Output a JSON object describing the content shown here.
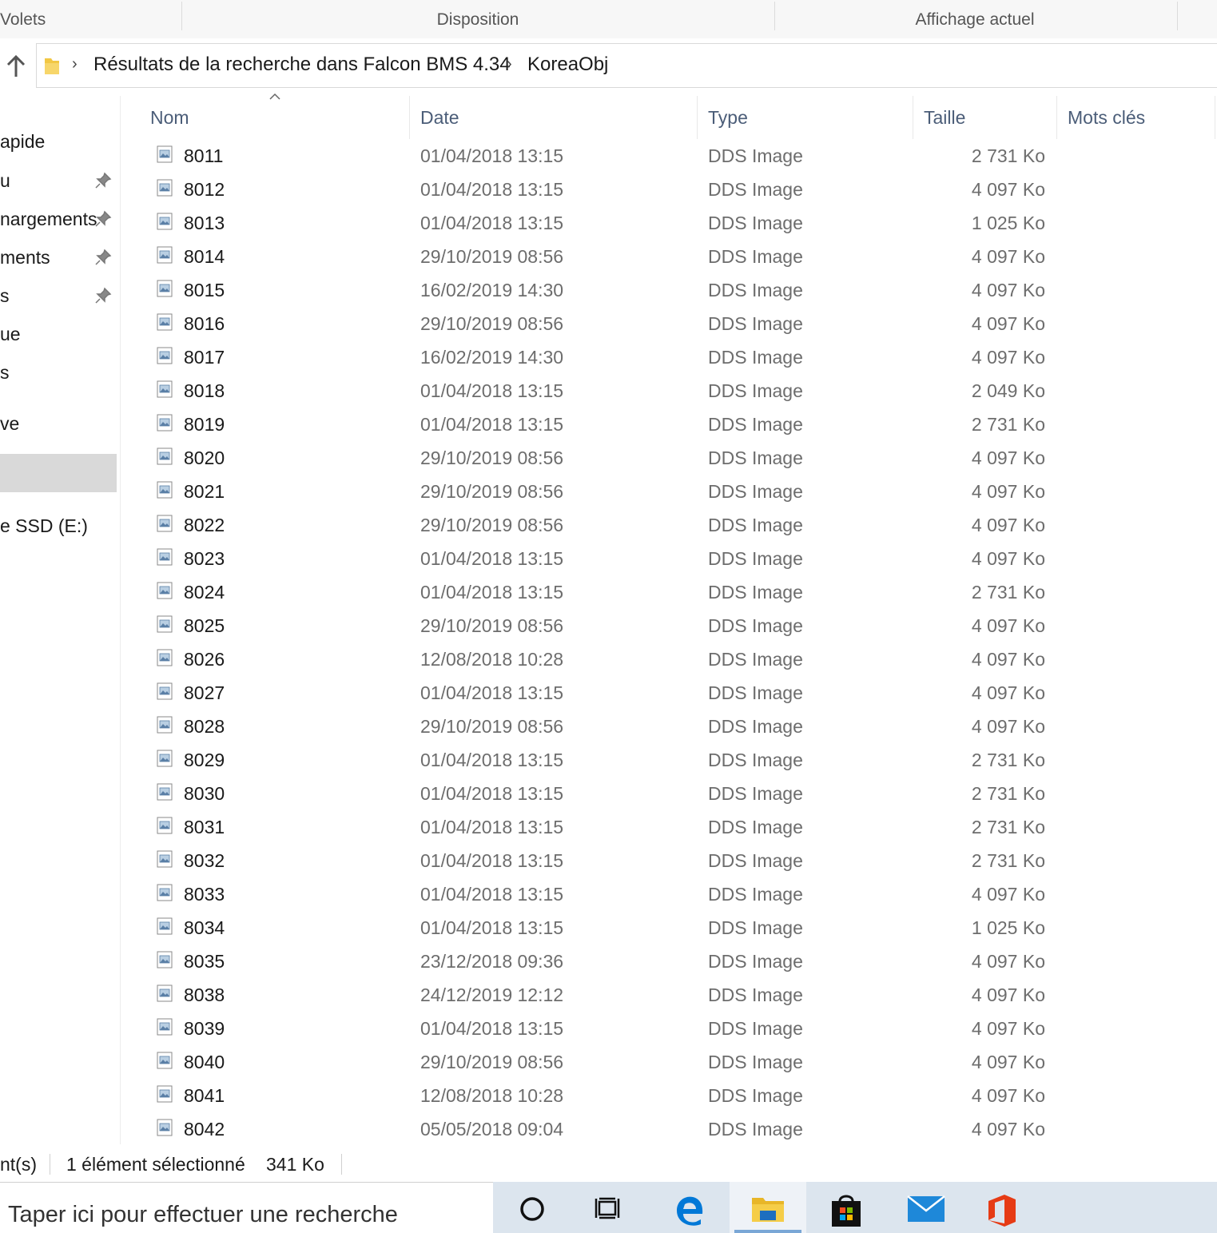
{
  "ribbon": {
    "groups": [
      "Volets",
      "Disposition",
      "Affichage actuel"
    ]
  },
  "address": {
    "crumbs": [
      "Résultats de la recherche dans Falcon BMS 4.34",
      "KoreaObj"
    ]
  },
  "nav_pane": {
    "items": [
      "apide",
      "u",
      "nargements",
      "ments",
      "s",
      "ue",
      "s",
      "ve",
      "e SSD (E:)"
    ]
  },
  "columns": {
    "name": "Nom",
    "date": "Date",
    "type": "Type",
    "size": "Taille",
    "keywords": "Mots clés"
  },
  "files": [
    {
      "name": "8011",
      "date": "01/04/2018 13:15",
      "type": "DDS Image",
      "size": "2 731 Ko"
    },
    {
      "name": "8012",
      "date": "01/04/2018 13:15",
      "type": "DDS Image",
      "size": "4 097 Ko"
    },
    {
      "name": "8013",
      "date": "01/04/2018 13:15",
      "type": "DDS Image",
      "size": "1 025 Ko"
    },
    {
      "name": "8014",
      "date": "29/10/2019 08:56",
      "type": "DDS Image",
      "size": "4 097 Ko"
    },
    {
      "name": "8015",
      "date": "16/02/2019 14:30",
      "type": "DDS Image",
      "size": "4 097 Ko"
    },
    {
      "name": "8016",
      "date": "29/10/2019 08:56",
      "type": "DDS Image",
      "size": "4 097 Ko"
    },
    {
      "name": "8017",
      "date": "16/02/2019 14:30",
      "type": "DDS Image",
      "size": "4 097 Ko"
    },
    {
      "name": "8018",
      "date": "01/04/2018 13:15",
      "type": "DDS Image",
      "size": "2 049 Ko"
    },
    {
      "name": "8019",
      "date": "01/04/2018 13:15",
      "type": "DDS Image",
      "size": "2 731 Ko"
    },
    {
      "name": "8020",
      "date": "29/10/2019 08:56",
      "type": "DDS Image",
      "size": "4 097 Ko"
    },
    {
      "name": "8021",
      "date": "29/10/2019 08:56",
      "type": "DDS Image",
      "size": "4 097 Ko"
    },
    {
      "name": "8022",
      "date": "29/10/2019 08:56",
      "type": "DDS Image",
      "size": "4 097 Ko"
    },
    {
      "name": "8023",
      "date": "01/04/2018 13:15",
      "type": "DDS Image",
      "size": "4 097 Ko"
    },
    {
      "name": "8024",
      "date": "01/04/2018 13:15",
      "type": "DDS Image",
      "size": "2 731 Ko"
    },
    {
      "name": "8025",
      "date": "29/10/2019 08:56",
      "type": "DDS Image",
      "size": "4 097 Ko"
    },
    {
      "name": "8026",
      "date": "12/08/2018 10:28",
      "type": "DDS Image",
      "size": "4 097 Ko"
    },
    {
      "name": "8027",
      "date": "01/04/2018 13:15",
      "type": "DDS Image",
      "size": "4 097 Ko"
    },
    {
      "name": "8028",
      "date": "29/10/2019 08:56",
      "type": "DDS Image",
      "size": "4 097 Ko"
    },
    {
      "name": "8029",
      "date": "01/04/2018 13:15",
      "type": "DDS Image",
      "size": "2 731 Ko"
    },
    {
      "name": "8030",
      "date": "01/04/2018 13:15",
      "type": "DDS Image",
      "size": "2 731 Ko"
    },
    {
      "name": "8031",
      "date": "01/04/2018 13:15",
      "type": "DDS Image",
      "size": "2 731 Ko"
    },
    {
      "name": "8032",
      "date": "01/04/2018 13:15",
      "type": "DDS Image",
      "size": "2 731 Ko"
    },
    {
      "name": "8033",
      "date": "01/04/2018 13:15",
      "type": "DDS Image",
      "size": "4 097 Ko"
    },
    {
      "name": "8034",
      "date": "01/04/2018 13:15",
      "type": "DDS Image",
      "size": "1 025 Ko"
    },
    {
      "name": "8035",
      "date": "23/12/2018 09:36",
      "type": "DDS Image",
      "size": "4 097 Ko"
    },
    {
      "name": "8038",
      "date": "24/12/2019 12:12",
      "type": "DDS Image",
      "size": "4 097 Ko"
    },
    {
      "name": "8039",
      "date": "01/04/2018 13:15",
      "type": "DDS Image",
      "size": "4 097 Ko"
    },
    {
      "name": "8040",
      "date": "29/10/2019 08:56",
      "type": "DDS Image",
      "size": "4 097 Ko"
    },
    {
      "name": "8041",
      "date": "12/08/2018 10:28",
      "type": "DDS Image",
      "size": "4 097 Ko"
    },
    {
      "name": "8042",
      "date": "05/05/2018 09:04",
      "type": "DDS Image",
      "size": "4 097 Ko"
    }
  ],
  "status": {
    "count": "nt(s)",
    "selection": "1 élément sélectionné",
    "selection_size": "341 Ko"
  },
  "taskbar": {
    "search_placeholder": "Taper ici pour effectuer une recherche",
    "icons": [
      "cortana-icon",
      "task-view-icon",
      "edge-icon",
      "file-explorer-icon",
      "store-icon",
      "mail-icon",
      "office-icon"
    ]
  },
  "colors": {
    "header_text": "#4b5d78",
    "secondary_text": "#6d6d6d",
    "selection": "#d9d9d9",
    "taskbar": "#dce5ee"
  }
}
